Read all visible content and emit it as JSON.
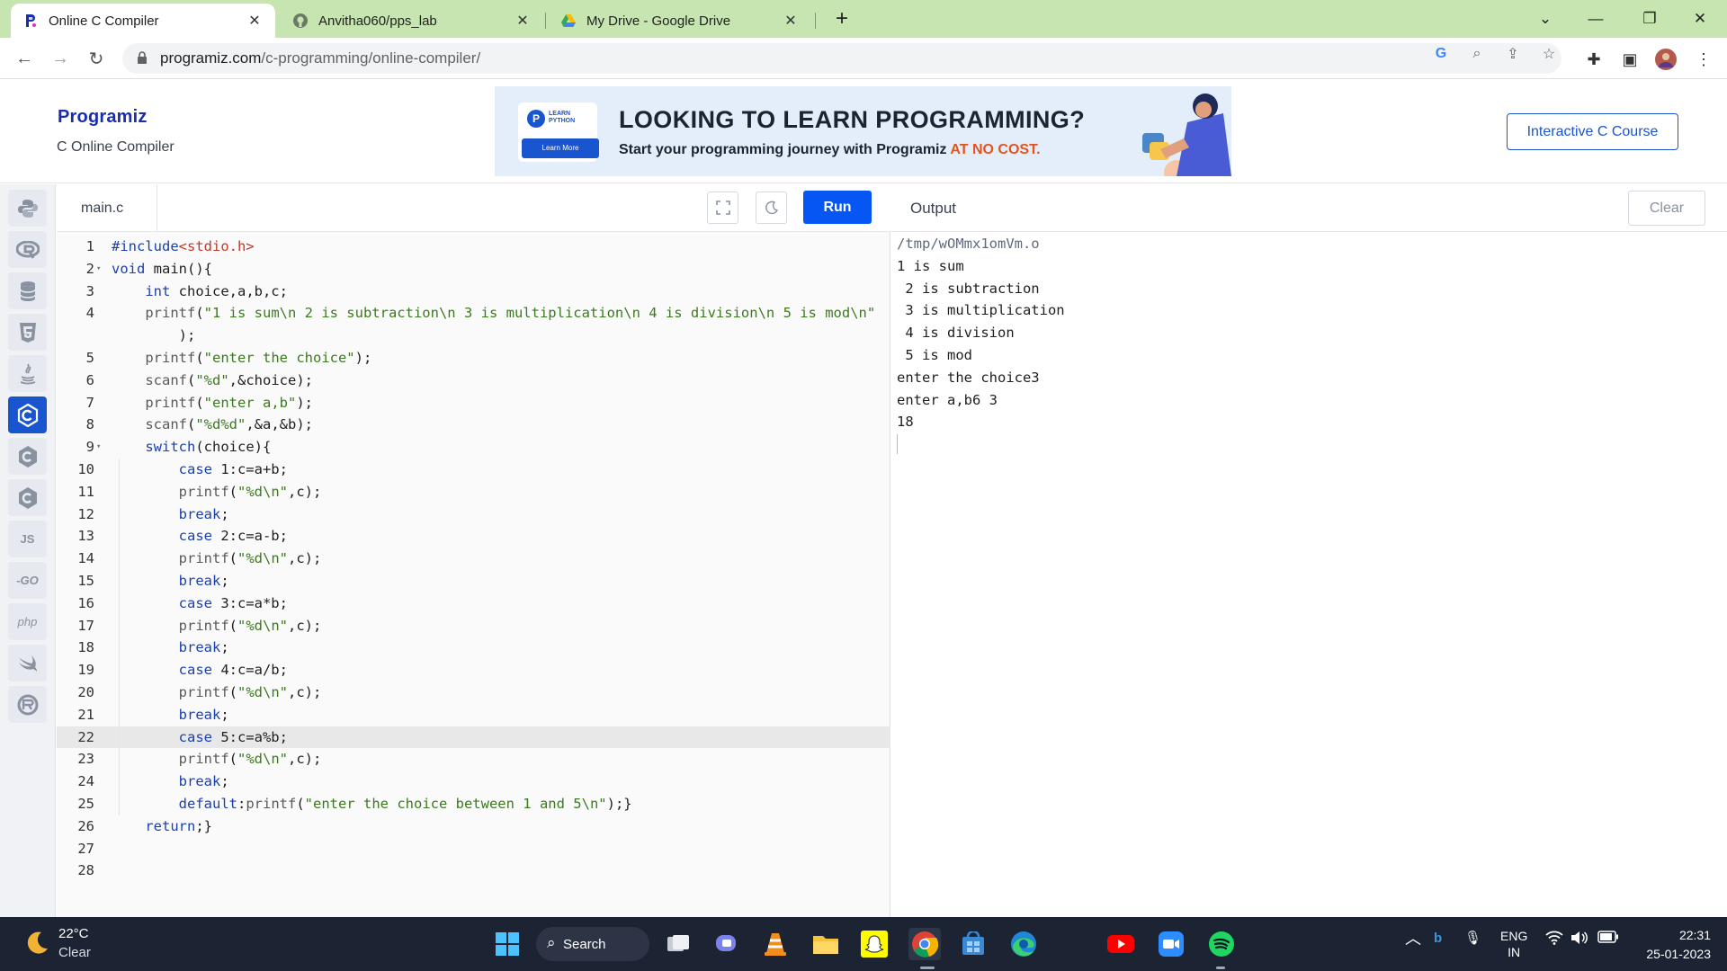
{
  "browser": {
    "tabs": [
      {
        "label": "Online C Compiler",
        "active": true,
        "icon": "programiz-favicon"
      },
      {
        "label": "Anvitha060/pps_lab",
        "active": false,
        "icon": "github-favicon"
      },
      {
        "label": "My Drive - Google Drive",
        "active": false,
        "icon": "google-drive-favicon"
      }
    ],
    "url_host": "programiz.com",
    "url_path": "/c-programming/online-compiler/"
  },
  "header": {
    "logo": "Programiz",
    "subtitle": "C Online Compiler",
    "banner_badge": "LEARN PYTHON",
    "banner_button": "Learn More",
    "banner_title": "LOOKING TO LEARN PROGRAMMING?",
    "banner_sub_pre": "Start your programming journey with Programiz",
    "banner_sub_hl": "AT NO COST.",
    "course_button": "Interactive C Course"
  },
  "sidebar": {
    "items": [
      {
        "name": "python-icon",
        "label": ""
      },
      {
        "name": "r-icon",
        "label": ""
      },
      {
        "name": "sql-icon",
        "label": ""
      },
      {
        "name": "html-icon",
        "label": ""
      },
      {
        "name": "java-icon",
        "label": ""
      },
      {
        "name": "c-icon",
        "label": "",
        "active": true
      },
      {
        "name": "cpp-icon",
        "label": ""
      },
      {
        "name": "csharp-icon",
        "label": ""
      },
      {
        "name": "js-icon",
        "label": "JS"
      },
      {
        "name": "go-icon",
        "label": "-GO"
      },
      {
        "name": "php-icon",
        "label": "php"
      },
      {
        "name": "swift-icon",
        "label": ""
      },
      {
        "name": "rust-icon",
        "label": ""
      }
    ]
  },
  "editor": {
    "file_name": "main.c",
    "run_label": "Run",
    "active_line": 22,
    "lines": [
      {
        "n": "1",
        "text": "#include<stdio.h>"
      },
      {
        "n": "2",
        "text": "void main(){",
        "fold": true
      },
      {
        "n": "3",
        "text": "    int choice,a,b,c;"
      },
      {
        "n": "4",
        "text": "    printf(\"1 is sum\\n 2 is subtraction\\n 3 is multiplication\\n 4 is division\\n 5 is mod\\n\""
      },
      {
        "n": "",
        "text": "        );"
      },
      {
        "n": "5",
        "text": "    printf(\"enter the choice\");"
      },
      {
        "n": "6",
        "text": "    scanf(\"%d\",&choice);"
      },
      {
        "n": "7",
        "text": "    printf(\"enter a,b\");"
      },
      {
        "n": "8",
        "text": "    scanf(\"%d%d\",&a,&b);"
      },
      {
        "n": "9",
        "text": "    switch(choice){",
        "fold": true
      },
      {
        "n": "10",
        "text": "        case 1:c=a+b;"
      },
      {
        "n": "11",
        "text": "        printf(\"%d\\n\",c);"
      },
      {
        "n": "12",
        "text": "        break;"
      },
      {
        "n": "13",
        "text": "        case 2:c=a-b;"
      },
      {
        "n": "14",
        "text": "        printf(\"%d\\n\",c);"
      },
      {
        "n": "15",
        "text": "        break;"
      },
      {
        "n": "16",
        "text": "        case 3:c=a*b;"
      },
      {
        "n": "17",
        "text": "        printf(\"%d\\n\",c);"
      },
      {
        "n": "18",
        "text": "        break;"
      },
      {
        "n": "19",
        "text": "        case 4:c=a/b;"
      },
      {
        "n": "20",
        "text": "        printf(\"%d\\n\",c);"
      },
      {
        "n": "21",
        "text": "        break;"
      },
      {
        "n": "22",
        "text": "        case 5:c=a%b;"
      },
      {
        "n": "23",
        "text": "        printf(\"%d\\n\",c);"
      },
      {
        "n": "24",
        "text": "        break;"
      },
      {
        "n": "25",
        "text": "        default:printf(\"enter the choice between 1 and 5\\n\");}"
      },
      {
        "n": "26",
        "text": "    return;}"
      },
      {
        "n": "27",
        "text": ""
      },
      {
        "n": "28",
        "text": ""
      }
    ]
  },
  "output": {
    "title": "Output",
    "clear_label": "Clear",
    "path": "/tmp/wOMmx1omVm.o",
    "text": "1 is sum\n 2 is subtraction\n 3 is multiplication\n 4 is division\n 5 is mod\nenter the choice3\nenter a,b6 3\n18"
  },
  "taskbar": {
    "temperature": "22°C",
    "weather": "Clear",
    "search_label": "Search",
    "lang_top": "ENG",
    "lang_bottom": "IN",
    "time": "22:31",
    "date": "25-01-2023"
  },
  "colors": {
    "tab_strip": "#c6e5b0",
    "accent": "#0556f3",
    "active_lang": "#1a55d0",
    "taskbar": "#1c2433"
  }
}
